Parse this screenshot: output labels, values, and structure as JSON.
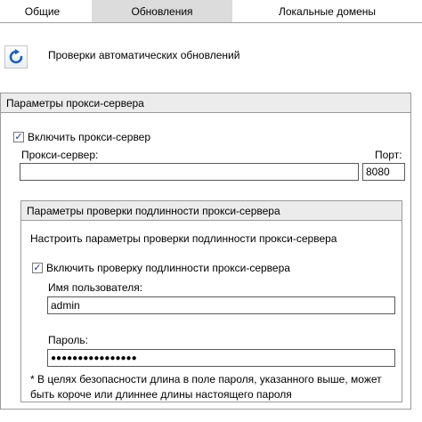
{
  "tabs": [
    {
      "label": "Общие"
    },
    {
      "label": "Обновления"
    },
    {
      "label": "Локальные домены"
    }
  ],
  "auto_updates": {
    "icon": "refresh-icon",
    "label": "Проверки автоматических обновлений"
  },
  "proxy": {
    "header": "Параметры прокси-сервера",
    "enable_label": "Включить прокси-сервер",
    "enable_checked": true,
    "server_label": "Прокси-сервер:",
    "server_value": "",
    "port_label": "Порт:",
    "port_value": "8080"
  },
  "auth": {
    "header": "Параметры проверки подлинности прокси-сервера",
    "description": "Настроить параметры проверки подлинности прокси-сервера",
    "enable_label": "Включить проверку подлинности прокси-сервера",
    "enable_checked": true,
    "username_label": "Имя пользователя:",
    "username_value": "admin",
    "password_label": "Пароль:",
    "password_value": "●●●●●●●●●●●●●●●●",
    "note_line1": "* В целях безопасности длина в поле пароля, указанного выше, может",
    "note_line2": "быть короче или длиннее длины настоящего пароля"
  },
  "colors": {
    "active_tab": "#dcdcdc",
    "header_bg": "#ececec",
    "border": "#9a9a9a",
    "icon_blue": "#1e5fb4"
  }
}
